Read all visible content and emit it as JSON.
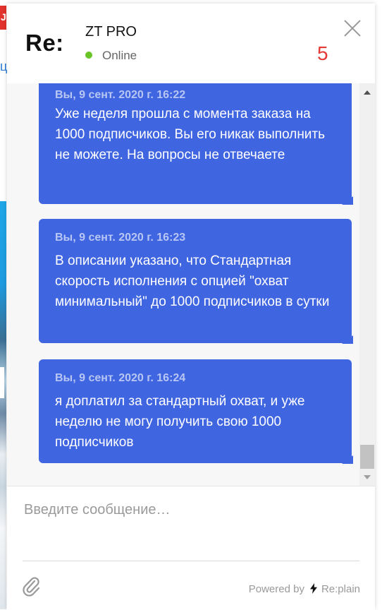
{
  "background": {
    "tab_letter": "J",
    "link_char": "ц"
  },
  "header": {
    "logo": "Re:",
    "title": "ZT PRO",
    "status": "Online",
    "badge": "5",
    "close_icon": "close-icon"
  },
  "messages": [
    {
      "time": "Вы, 9 сент. 2020 г. 16:22",
      "text": "Уже неделя прошла с момента заказа на 1000 подписчиков. Вы его никак выполнить не можете. На вопросы не отвечаете"
    },
    {
      "time": "Вы, 9 сент. 2020 г. 16:23",
      "text": "В описании указано, что Стандартная скорость исполнения с опцией \"охват минимальный\" до 1000 подписчиков в сутки"
    },
    {
      "time": "Вы, 9 сент. 2020 г. 16:24",
      "text": "я доплатил за стандартный охват, и уже неделю не могу получить свою 1000 подписчиков"
    }
  ],
  "composer": {
    "value": "",
    "placeholder": "Введите сообщение…",
    "attach_icon": "paperclip-icon",
    "powered_by": "Powered by",
    "brand": "Re:plain"
  },
  "colors": {
    "bubble": "#4065e0",
    "status_online": "#6ac529",
    "badge": "#e53935"
  }
}
